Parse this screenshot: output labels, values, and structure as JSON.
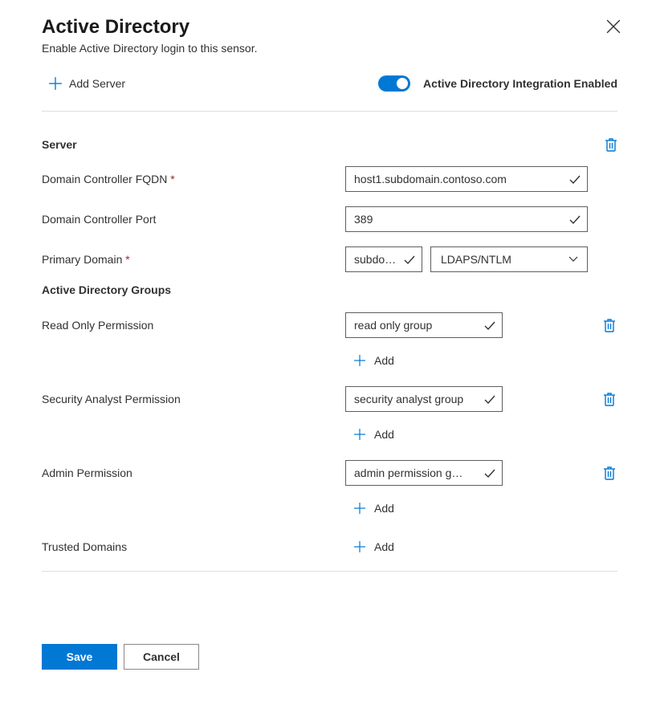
{
  "header": {
    "title": "Active Directory",
    "subtitle": "Enable Active Directory login to this sensor."
  },
  "toolbar": {
    "add_server_label": "Add Server",
    "toggle_label": "Active Directory Integration Enabled",
    "toggle_enabled": true
  },
  "server": {
    "section_label": "Server",
    "fqdn_label": "Domain Controller FQDN",
    "fqdn_value": "host1.subdomain.contoso.com",
    "port_label": "Domain Controller Port",
    "port_value": "389",
    "primary_domain_label": "Primary Domain",
    "primary_domain_value": "subdo…",
    "auth_method_value": "LDAPS/NTLM"
  },
  "groups": {
    "section_label": "Active Directory Groups",
    "readonly": {
      "label": "Read Only Permission",
      "value": "read only group",
      "add_label": "Add"
    },
    "analyst": {
      "label": "Security Analyst Permission",
      "value": "security analyst group",
      "add_label": "Add"
    },
    "admin": {
      "label": "Admin Permission",
      "value": "admin permission g…",
      "add_label": "Add"
    }
  },
  "trusted": {
    "label": "Trusted Domains",
    "add_label": "Add"
  },
  "footer": {
    "save_label": "Save",
    "cancel_label": "Cancel"
  },
  "colors": {
    "accent": "#0078d4",
    "required": "#a4262c"
  }
}
